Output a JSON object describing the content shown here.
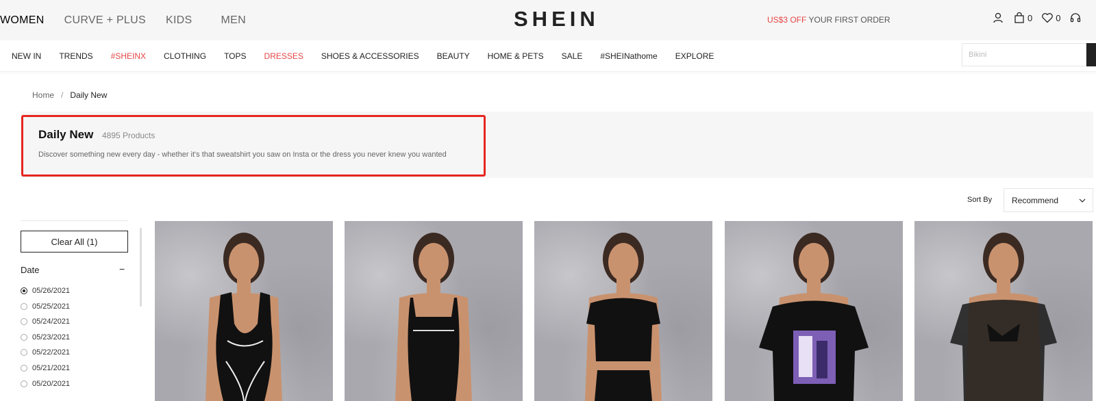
{
  "top": {
    "tabs": [
      "WOMEN",
      "CURVE + PLUS",
      "KIDS",
      "MEN"
    ],
    "logo": "SHEIN",
    "promo_highlight": "US$3 OFF",
    "promo_text": " YOUR FIRST ORDER",
    "bag_count": "0",
    "wishlist_count": "0"
  },
  "nav": {
    "items": [
      {
        "label": "NEW IN",
        "red": false
      },
      {
        "label": "TRENDS",
        "red": false
      },
      {
        "label": "#SHEINX",
        "red": true
      },
      {
        "label": "CLOTHING",
        "red": false
      },
      {
        "label": "TOPS",
        "red": false
      },
      {
        "label": "DRESSES",
        "red": true
      },
      {
        "label": "SHOES & ACCESSORIES",
        "red": false
      },
      {
        "label": "BEAUTY",
        "red": false
      },
      {
        "label": "HOME & PETS",
        "red": false
      },
      {
        "label": "SALE",
        "red": false
      },
      {
        "label": "#SHEINathome",
        "red": false
      },
      {
        "label": "EXPLORE",
        "red": false
      }
    ],
    "search_placeholder": "Bikini"
  },
  "breadcrumb": {
    "home": "Home",
    "sep": "/",
    "current": "Daily New"
  },
  "category": {
    "title": "Daily New",
    "count": "4895 Products",
    "description": "Discover something new every day - whether it's that sweatshirt you saw on Insta or the dress you never knew you wanted"
  },
  "sort": {
    "label": "Sort By",
    "value": "Recommend"
  },
  "filter": {
    "clear_label": "Clear All (1)",
    "date_title": "Date",
    "date_toggle": "−",
    "dates": [
      "05/26/2021",
      "05/25/2021",
      "05/24/2021",
      "05/23/2021",
      "05/22/2021",
      "05/21/2021",
      "05/20/2021"
    ],
    "selected_index": 0
  },
  "products": [
    {
      "name": "black-bodysuit-product"
    },
    {
      "name": "black-tank-dress-product"
    },
    {
      "name": "black-crop-top-product"
    },
    {
      "name": "graphic-tee-dress-product"
    },
    {
      "name": "mesh-top-product"
    }
  ],
  "colors": {
    "accent": "#e64545",
    "highlight_border": "#e6261f",
    "header_bg": "#f6f6f6"
  }
}
